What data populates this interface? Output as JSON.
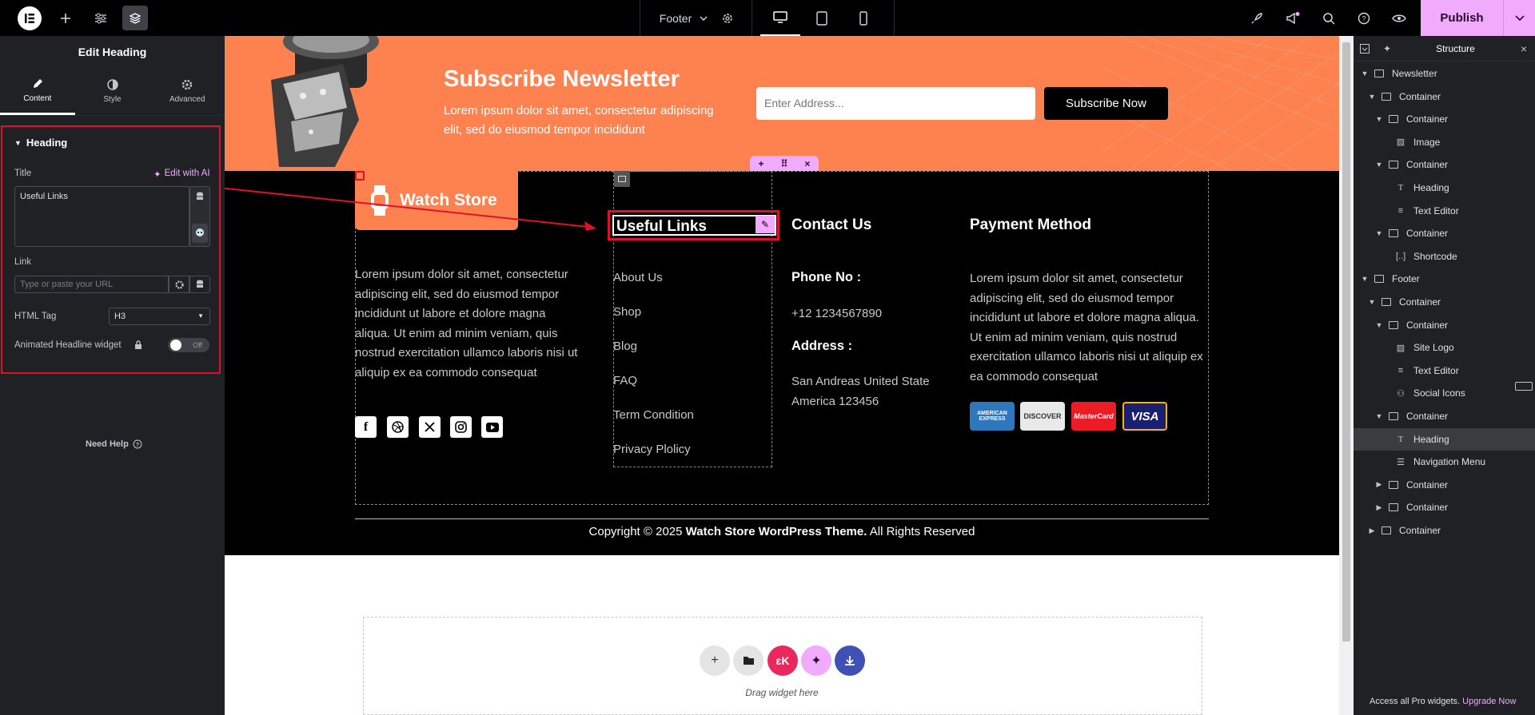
{
  "topbar": {
    "template_name": "Footer",
    "publish_label": "Publish"
  },
  "left_panel": {
    "title": "Edit Heading",
    "tabs": [
      {
        "label": "Content",
        "icon": "pencil-icon",
        "active": true
      },
      {
        "label": "Style",
        "icon": "half-circle-icon",
        "active": false
      },
      {
        "label": "Advanced",
        "icon": "gear-icon",
        "active": false
      }
    ],
    "section_title": "Heading",
    "title_label": "Title",
    "edit_ai_label": "Edit with AI",
    "title_value": "Useful Links",
    "link_label": "Link",
    "link_placeholder": "Type or paste your URL",
    "html_tag_label": "HTML Tag",
    "html_tag_value": "H3",
    "animated_label": "Animated Headline widget",
    "toggle_label": "Off",
    "need_help": "Need Help"
  },
  "canvas": {
    "newsletter": {
      "title": "Subscribe Newsletter",
      "text": "Lorem ipsum dolor sit amet, consectetur adipiscing elit, sed do eiusmod tempor incididunt",
      "email_placeholder": "Enter Address...",
      "button_label": "Subscribe Now"
    },
    "footer": {
      "logo_text": "Watch Store",
      "about_text": "Lorem ipsum dolor sit amet, consectetur adipiscing elit, sed do eiusmod tempor incididunt ut labore et dolore magna aliqua. Ut enim ad minim veniam, quis nostrud exercitation ullamco laboris nisi ut aliquip ex ea commodo consequat",
      "useful_links_heading": "Useful Links",
      "links": [
        "About Us",
        "Shop",
        "Blog",
        "FAQ",
        "Term Condition",
        "Privacy Plolicy"
      ],
      "contact_heading": "Contact Us",
      "phone_label": "Phone No :",
      "phone_value": "+12 1234567890",
      "address_label": "Address :",
      "address_value": "San Andreas United State America 123456",
      "payment_heading": "Payment Method",
      "payment_text": "Lorem ipsum dolor sit amet, consectetur adipiscing elit, sed do eiusmod tempor incididunt ut labore et dolore magna aliqua. Ut enim ad minim veniam, quis nostrud exercitation ullamco laboris nisi ut aliquip ex ea commodo consequat",
      "cards": [
        "AMERICAN EXPRESS",
        "DISCOVER",
        "MasterCard",
        "VISA"
      ],
      "copyright_prefix": "Copyright © 2025 ",
      "copyright_bold": "Watch Store WordPress Theme.",
      "copyright_suffix": " All Rights Reserved"
    },
    "drag_text": "Drag widget here"
  },
  "structure": {
    "title": "Structure",
    "items": [
      {
        "label": "Newsletter",
        "depth": 0,
        "caret": "down",
        "icon": "container"
      },
      {
        "label": "Container",
        "depth": 1,
        "caret": "down",
        "icon": "container"
      },
      {
        "label": "Container",
        "depth": 2,
        "caret": "down",
        "icon": "container"
      },
      {
        "label": "Image",
        "depth": 3,
        "caret": "",
        "icon": "image"
      },
      {
        "label": "Container",
        "depth": 2,
        "caret": "down",
        "icon": "container"
      },
      {
        "label": "Heading",
        "depth": 3,
        "caret": "",
        "icon": "heading"
      },
      {
        "label": "Text Editor",
        "depth": 3,
        "caret": "",
        "icon": "text"
      },
      {
        "label": "Container",
        "depth": 2,
        "caret": "down",
        "icon": "container"
      },
      {
        "label": "Shortcode",
        "depth": 3,
        "caret": "",
        "icon": "shortcode"
      },
      {
        "label": "Footer",
        "depth": 0,
        "caret": "down",
        "icon": "container"
      },
      {
        "label": "Container",
        "depth": 1,
        "caret": "down",
        "icon": "container"
      },
      {
        "label": "Container",
        "depth": 2,
        "caret": "down",
        "icon": "container"
      },
      {
        "label": "Site Logo",
        "depth": 3,
        "caret": "",
        "icon": "image"
      },
      {
        "label": "Text Editor",
        "depth": 3,
        "caret": "",
        "icon": "text"
      },
      {
        "label": "Social Icons",
        "depth": 3,
        "caret": "",
        "icon": "social"
      },
      {
        "label": "Container",
        "depth": 2,
        "caret": "down",
        "icon": "container"
      },
      {
        "label": "Heading",
        "depth": 3,
        "caret": "",
        "icon": "heading",
        "highlighted": true
      },
      {
        "label": "Navigation Menu",
        "depth": 3,
        "caret": "",
        "icon": "menu"
      },
      {
        "label": "Container",
        "depth": 2,
        "caret": "right",
        "icon": "container"
      },
      {
        "label": "Container",
        "depth": 2,
        "caret": "right",
        "icon": "container"
      },
      {
        "label": "Container",
        "depth": 1,
        "caret": "right",
        "icon": "container"
      }
    ],
    "pro_text": "Access all Pro widgets. ",
    "pro_link": "Upgrade Now"
  },
  "colors": {
    "accent_pink": "#f0abfc",
    "newsletter_orange": "#fd8250",
    "selection_red": "#e0102a"
  }
}
